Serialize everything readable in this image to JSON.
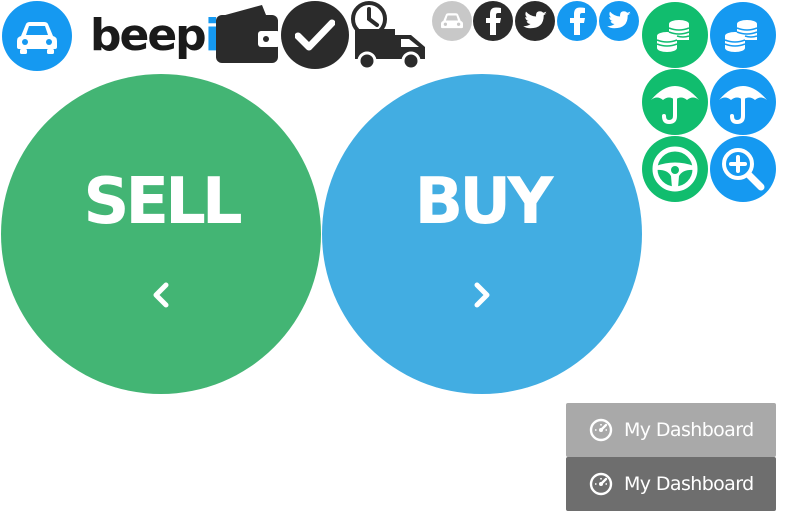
{
  "brand": {
    "wordmark_text": "beep",
    "wordmark_i": "i",
    "blue": "#1599f1",
    "green": "#11bd6e"
  },
  "header_icons": [
    "car-logo-icon",
    "wallet-icon",
    "checkmark-icon",
    "delivery-truck-clock-icon",
    "car-gray-icon",
    "facebook-dark-icon",
    "twitter-dark-icon",
    "facebook-blue-icon",
    "twitter-blue-icon"
  ],
  "feature_icons": [
    "coins-green-icon",
    "coins-blue-icon",
    "umbrella-green-icon",
    "umbrella-blue-icon",
    "steering-wheel-icon",
    "zoom-in-icon"
  ],
  "sell": {
    "label": "SELL",
    "color": "#43b574",
    "chevron": "chevron-left-icon"
  },
  "buy": {
    "label": "BUY",
    "color": "#42ade2",
    "chevron": "chevron-right-icon"
  },
  "dashboard_buttons": [
    {
      "label": "My Dashboard",
      "color": "#a9a9a9"
    },
    {
      "label": "My Dashboard",
      "color": "#6e6e6e"
    }
  ]
}
